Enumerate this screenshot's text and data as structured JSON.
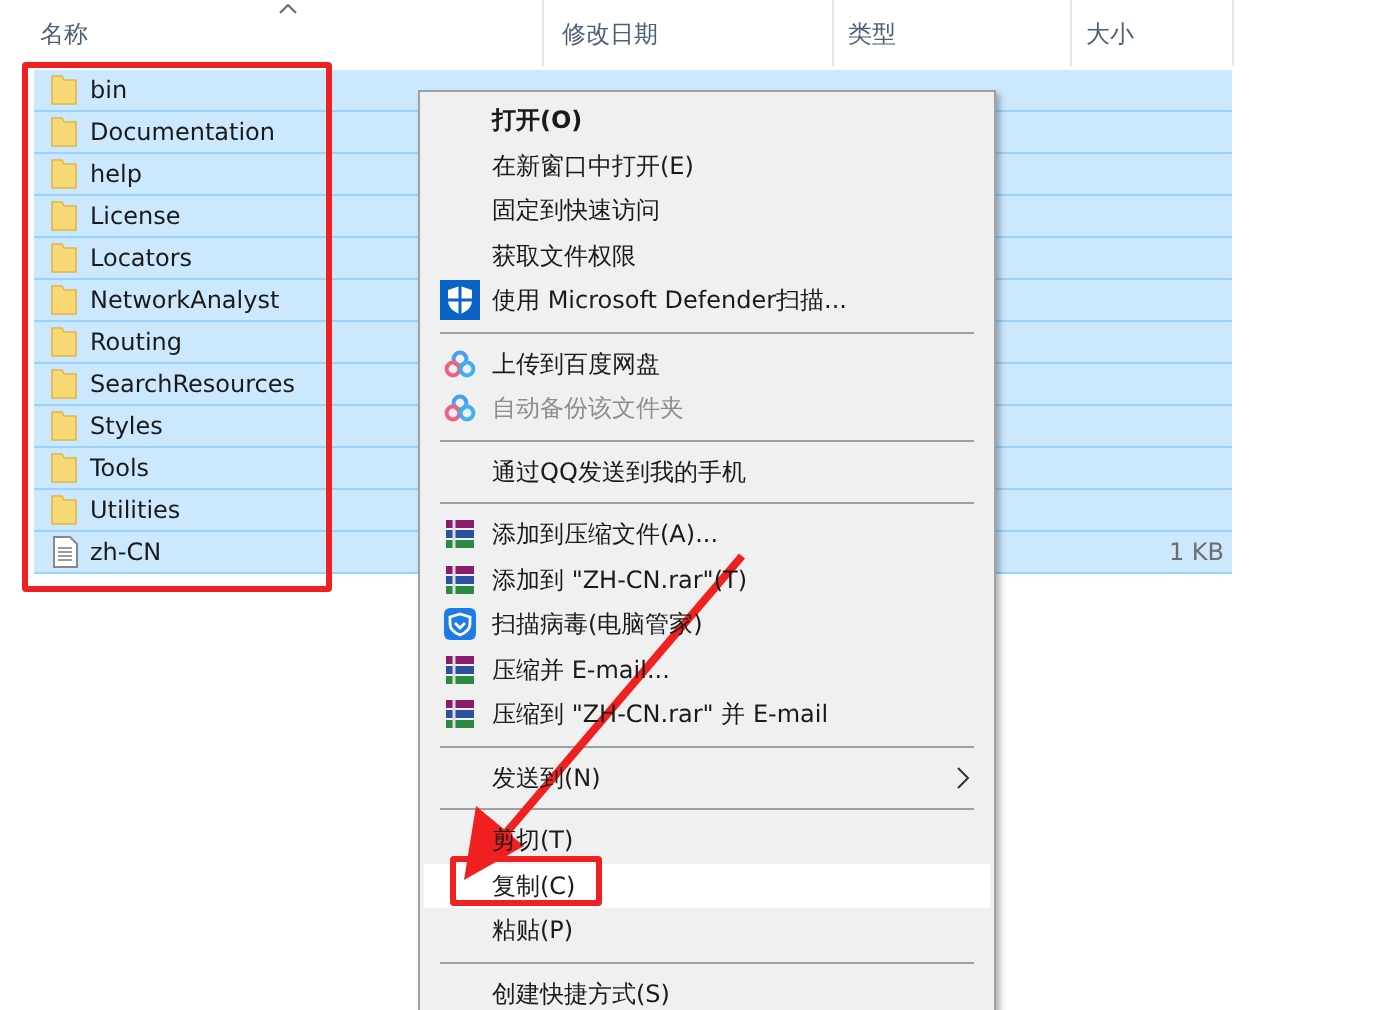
{
  "columns": [
    {
      "label": "名称",
      "sorted": true
    },
    {
      "label": "修改日期",
      "sorted": false
    },
    {
      "label": "类型",
      "sorted": false
    },
    {
      "label": "大小",
      "sorted": false
    }
  ],
  "files": [
    {
      "kind": "folder",
      "name": "bin",
      "selected": true
    },
    {
      "kind": "folder",
      "name": "Documentation",
      "selected": true
    },
    {
      "kind": "folder",
      "name": "help",
      "selected": true
    },
    {
      "kind": "folder",
      "name": "License",
      "selected": true
    },
    {
      "kind": "folder",
      "name": "Locators",
      "selected": true
    },
    {
      "kind": "folder",
      "name": "NetworkAnalyst",
      "selected": true
    },
    {
      "kind": "folder",
      "name": "Routing",
      "selected": true
    },
    {
      "kind": "folder",
      "name": "SearchResources",
      "selected": true
    },
    {
      "kind": "folder",
      "name": "Styles",
      "selected": true
    },
    {
      "kind": "folder",
      "name": "Tools",
      "selected": true
    },
    {
      "kind": "folder",
      "name": "Utilities",
      "selected": true
    },
    {
      "kind": "file",
      "name": "zh-CN",
      "selected": true,
      "size": "1 KB"
    }
  ],
  "menu": [
    {
      "kind": "plain",
      "label": "打开(O)",
      "default": true,
      "selected": false,
      "disabled": false
    },
    {
      "kind": "plain",
      "label": "在新窗口中打开(E)",
      "default": false,
      "selected": false,
      "disabled": false
    },
    {
      "kind": "plain",
      "label": "固定到快速访问",
      "default": false,
      "selected": false,
      "disabled": false
    },
    {
      "kind": "plain",
      "label": "获取文件权限",
      "default": false,
      "selected": false,
      "disabled": false
    },
    {
      "kind": "defender",
      "label": "使用 Microsoft Defender扫描...",
      "default": false,
      "selected": false,
      "disabled": false
    },
    {
      "kind": "separator"
    },
    {
      "kind": "cloud",
      "label": "上传到百度网盘",
      "default": false,
      "selected": false,
      "disabled": false
    },
    {
      "kind": "cloud",
      "label": "自动备份该文件夹",
      "default": false,
      "selected": false,
      "disabled": true
    },
    {
      "kind": "separator"
    },
    {
      "kind": "plain",
      "label": "通过QQ发送到我的手机",
      "default": false,
      "selected": false,
      "disabled": false
    },
    {
      "kind": "separator"
    },
    {
      "kind": "archive",
      "label": "添加到压缩文件(A)...",
      "default": false,
      "selected": false,
      "disabled": false
    },
    {
      "kind": "archive",
      "label": "添加到 \"ZH-CN.rar\"(T)",
      "default": false,
      "selected": false,
      "disabled": false
    },
    {
      "kind": "guard",
      "label": "扫描病毒(电脑管家)",
      "default": false,
      "selected": false,
      "disabled": false
    },
    {
      "kind": "archive",
      "label": "压缩并 E-mail...",
      "default": false,
      "selected": false,
      "disabled": false
    },
    {
      "kind": "archive",
      "label": "压缩到 \"ZH-CN.rar\" 并 E-mail",
      "default": false,
      "selected": false,
      "disabled": false
    },
    {
      "kind": "separator"
    },
    {
      "kind": "submenu",
      "label": "发送到(N)",
      "default": false,
      "selected": false,
      "disabled": false
    },
    {
      "kind": "separator"
    },
    {
      "kind": "plain",
      "label": "剪切(T)",
      "default": false,
      "selected": false,
      "disabled": false
    },
    {
      "kind": "plain",
      "label": "复制(C)",
      "default": false,
      "selected": true,
      "disabled": false
    },
    {
      "kind": "plain",
      "label": "粘贴(P)",
      "default": false,
      "selected": false,
      "disabled": false
    },
    {
      "kind": "separator"
    },
    {
      "kind": "plain",
      "label": "创建快捷方式(S)",
      "default": false,
      "selected": false,
      "disabled": false
    }
  ]
}
